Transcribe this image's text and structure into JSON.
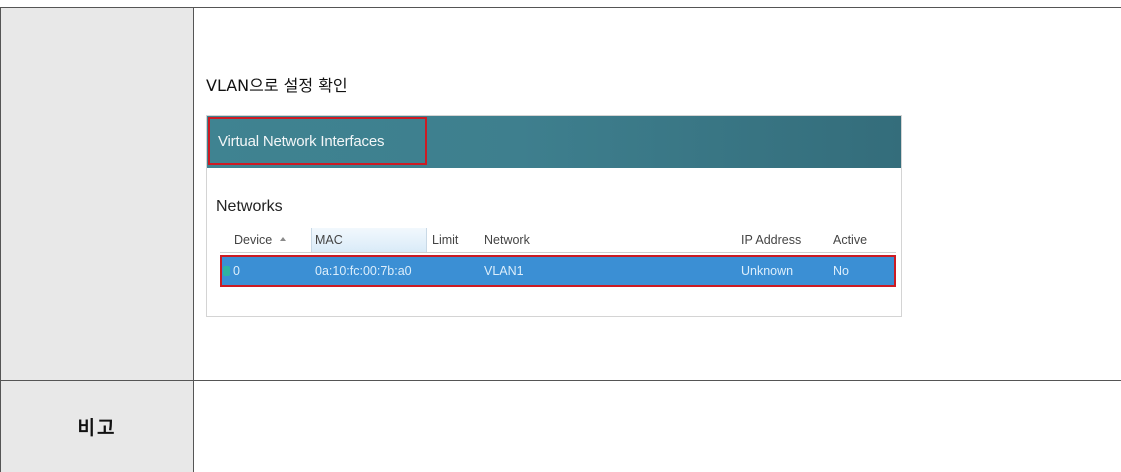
{
  "caption": "VLAN으로 설정 확인",
  "remark_label": "비고",
  "screenshot": {
    "title": "Virtual Network Interfaces",
    "section_label": "Networks",
    "columns": [
      "Device",
      "MAC",
      "Limit",
      "Network",
      "IP Address",
      "Active"
    ],
    "rows": [
      {
        "device": "0",
        "mac": "0a:10:fc:00:7b:a0",
        "limit": "",
        "network": "VLAN1",
        "ip_address": "Unknown",
        "active": "No"
      }
    ],
    "colors": {
      "header": "#3e7f8e",
      "selection": "#3b8fd4",
      "highlight_border": "#cc1b23"
    }
  }
}
